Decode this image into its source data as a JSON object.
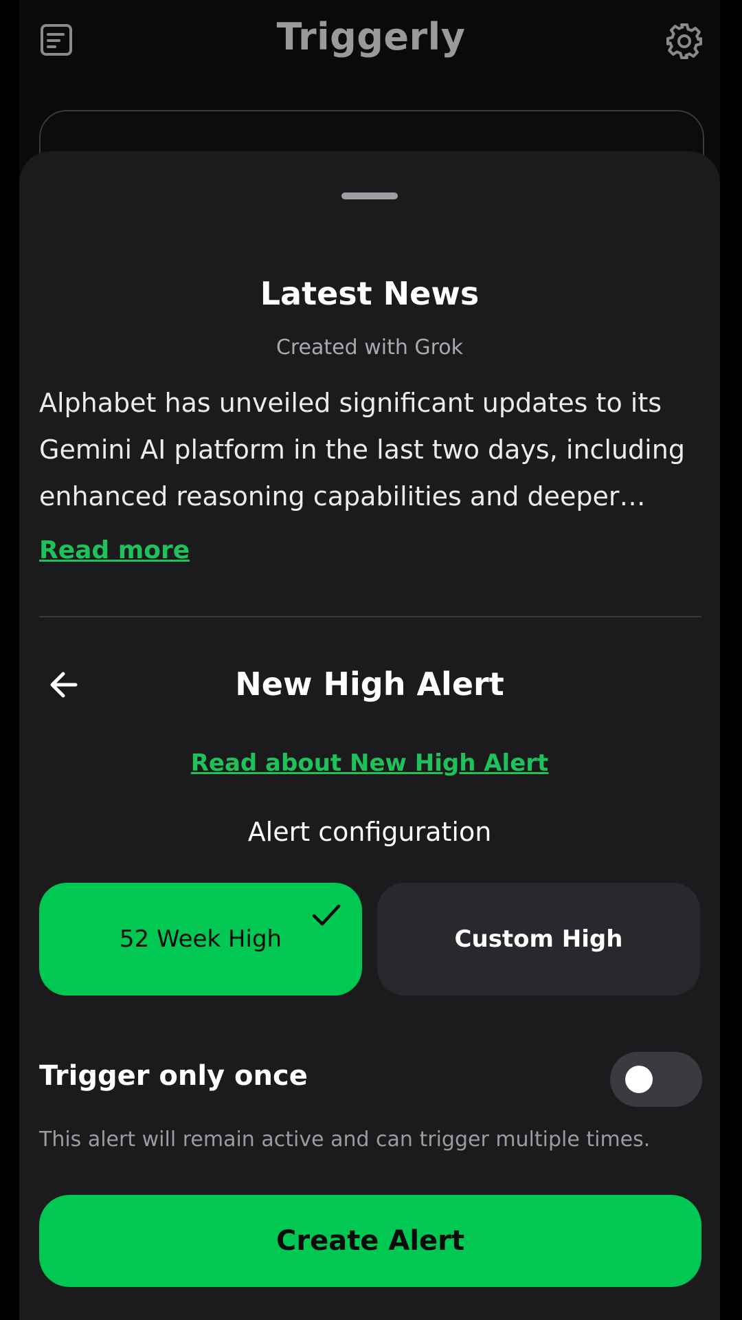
{
  "app": {
    "title": "Triggerly"
  },
  "news": {
    "title": "Latest News",
    "subtitle": "Created with Grok",
    "body": "Alphabet has unveiled significant updates to its Gemini AI platform in the last two days, including enhanced reasoning capabilities and deeper integration",
    "read_more": "Read more"
  },
  "alert": {
    "title": "New High Alert",
    "read_about": "Read about New High Alert",
    "config_label": "Alert configuration",
    "options": [
      {
        "label": "52 Week High",
        "selected": true
      },
      {
        "label": "Custom High",
        "selected": false
      }
    ],
    "trigger_once_label": "Trigger only once",
    "trigger_once_enabled": false,
    "trigger_description": "This alert will remain active and can trigger multiple times.",
    "create_label": "Create Alert"
  },
  "colors": {
    "accent": "#00c853",
    "sheet": "#1b1b1e",
    "card": "#29292d"
  }
}
